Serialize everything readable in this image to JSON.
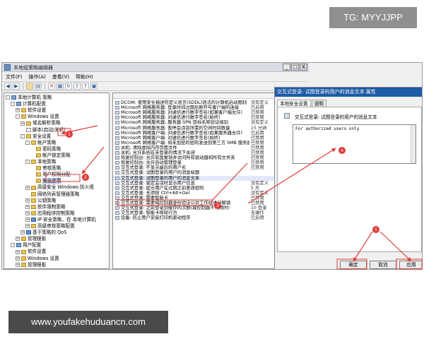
{
  "banners": {
    "tg": "TG: MYYJJPP",
    "url": "www.youfakehuduancn.com"
  },
  "window": {
    "title": "本地组策略编辑器",
    "controls": [
      "_",
      "□",
      "X"
    ]
  },
  "menu": [
    "文件(F)",
    "操作(A)",
    "查看(V)",
    "帮助(H)"
  ],
  "toolbar": [
    "back-icon",
    "forward-icon",
    "folder-up-icon",
    "show-tree-icon",
    "delete-icon",
    "properties-icon",
    "refresh-icon",
    "export-icon",
    "help-icon",
    "filter-icon"
  ],
  "tree": [
    {
      "label": "本地计算机 策略",
      "depth": 0,
      "toggle": "-",
      "icon": "pc"
    },
    {
      "label": "计算机配置",
      "depth": 1,
      "toggle": "-",
      "icon": "pc"
    },
    {
      "label": "软件设置",
      "depth": 2,
      "toggle": "+",
      "icon": "folder"
    },
    {
      "label": "Windows 设置",
      "depth": 2,
      "toggle": "-",
      "icon": "folder"
    },
    {
      "label": "域名解析策略",
      "depth": 3,
      "toggle": "+",
      "icon": "folder"
    },
    {
      "label": "脚本(启动/关机)",
      "depth": 3,
      "toggle": "",
      "icon": "doc"
    },
    {
      "label": "安全设置",
      "depth": 3,
      "toggle": "-",
      "icon": "folder"
    },
    {
      "label": "帐户策略",
      "depth": 4,
      "toggle": "-",
      "icon": "folder"
    },
    {
      "label": "密码策略",
      "depth": 5,
      "toggle": "",
      "icon": "folder"
    },
    {
      "label": "帐户锁定策略",
      "depth": 5,
      "toggle": "",
      "icon": "folder"
    },
    {
      "label": "本地策略",
      "depth": 4,
      "toggle": "-",
      "icon": "folder"
    },
    {
      "label": "审核策略",
      "depth": 5,
      "toggle": "",
      "icon": "folder"
    },
    {
      "label": "用户权限分配",
      "depth": 5,
      "toggle": "",
      "icon": "folder"
    },
    {
      "label": "安全选项",
      "depth": 5,
      "toggle": "",
      "icon": "folder"
    },
    {
      "label": "高级安全 Windows 防火墙",
      "depth": 4,
      "toggle": "+",
      "icon": "folder"
    },
    {
      "label": "网络列表管理器策略",
      "depth": 4,
      "toggle": "",
      "icon": "folder"
    },
    {
      "label": "公钥策略",
      "depth": 4,
      "toggle": "+",
      "icon": "folder"
    },
    {
      "label": "软件限制策略",
      "depth": 4,
      "toggle": "+",
      "icon": "folder"
    },
    {
      "label": "应用程序控制策略",
      "depth": 4,
      "toggle": "+",
      "icon": "folder"
    },
    {
      "label": "IP 安全策略，在 本地计算机",
      "depth": 4,
      "toggle": "+",
      "icon": "blue"
    },
    {
      "label": "高级审核策略配置",
      "depth": 4,
      "toggle": "+",
      "icon": "folder"
    },
    {
      "label": "基于策略的 QoS",
      "depth": 3,
      "toggle": "+",
      "icon": "blue"
    },
    {
      "label": "管理模板",
      "depth": 2,
      "toggle": "+",
      "icon": "folder"
    },
    {
      "label": "用户配置",
      "depth": 1,
      "toggle": "-",
      "icon": "pc"
    },
    {
      "label": "软件设置",
      "depth": 2,
      "toggle": "+",
      "icon": "folder"
    },
    {
      "label": "Windows 设置",
      "depth": 2,
      "toggle": "+",
      "icon": "folder"
    },
    {
      "label": "管理模板",
      "depth": 2,
      "toggle": "+",
      "icon": "folder"
    }
  ],
  "policy_list": [
    {
      "policy": "DCOM: 使用安全描述符定义语言(SDDL)语法的计算机启动限制",
      "value": "没有定义"
    },
    {
      "policy": "Microsoft 网络服务器: 登录时间过期后断开与客户端的连接",
      "value": "已启用"
    },
    {
      "policy": "Microsoft 网络服务器: 对通信进行数字签名(如果客户端允许)",
      "value": "已禁用"
    },
    {
      "policy": "Microsoft 网络服务器: 对通信进行数字签名(始终)",
      "value": "已禁用"
    },
    {
      "policy": "Microsoft 网络服务器: 服务器 SPN 目标名称验证级别",
      "value": "没有定义"
    },
    {
      "policy": "Microsoft 网络服务器: 暂停会话前所需的空闲时间数量",
      "value": "15 分钟"
    },
    {
      "policy": "Microsoft 网络客户端: 对通信进行数字签名(如果服务器允许)",
      "value": "已启用"
    },
    {
      "policy": "Microsoft 网络客户端: 对通信进行数字签名(始终)",
      "value": "已禁用"
    },
    {
      "policy": "Microsoft 网络客户端: 将未加密的密码发送到第三方 SMB 服务器",
      "value": "已禁用"
    },
    {
      "policy": "关机: 清除虚拟内存页面文件",
      "value": "已禁用"
    },
    {
      "policy": "关机: 允许系统在未登录的情况下关闭",
      "value": "已禁用"
    },
    {
      "policy": "恢复控制台: 允许软盘复制并访问所有驱动器和所有文件夹",
      "value": "已禁用"
    },
    {
      "policy": "恢复控制台: 允许自动管理登录",
      "value": "已禁用"
    },
    {
      "policy": "交互式登录: 不显示最后的用户名",
      "value": "已禁用"
    },
    {
      "policy": "交互式登录: 试图登录的用户的消息标题",
      "value": ""
    },
    {
      "policy": "交互式登录: 试图登录的用户的消息文本",
      "value": ""
    },
    {
      "policy": "交互式登录: 锁定会话时显示用户信息",
      "value": "没有定义"
    },
    {
      "policy": "交互式登录: 提示用户在过期之前更改密码",
      "value": "5 天"
    },
    {
      "policy": "交互式登录: 无须按 Ctrl+Alt+Del",
      "value": "没有定义"
    },
    {
      "policy": "交互式登录: 需要智能卡",
      "value": "已禁用"
    },
    {
      "policy": "交互式登录: 需要域控制器身份验证以对工作站进行解锁",
      "value": "已禁用"
    },
    {
      "policy": "交互式登录: 之前登录到缓存的次数(域控制器不可用时)",
      "value": "10 登录"
    },
    {
      "policy": "交互式登录: 智能卡移除行为",
      "value": "无操作"
    },
    {
      "policy": "设备: 防止用户安装打印机驱动程序",
      "value": "已启用"
    }
  ],
  "dialog": {
    "title": "交互式登录: 试图登录的用户的消息文本 属性",
    "tabs": [
      "本地安全设置",
      "说明"
    ],
    "policy_name": "交互式登录: 试图登录的用户的消息文本",
    "text_value": "For authorized users only",
    "buttons": [
      "确定",
      "取消",
      "应用"
    ]
  },
  "annotations": [
    "1",
    "2",
    "3",
    "4",
    "5"
  ],
  "colors": {
    "dialog_title_bg": "#1d5ca7",
    "annotation_red": "#e23a3a",
    "selection_bg": "#c6d9f5"
  }
}
